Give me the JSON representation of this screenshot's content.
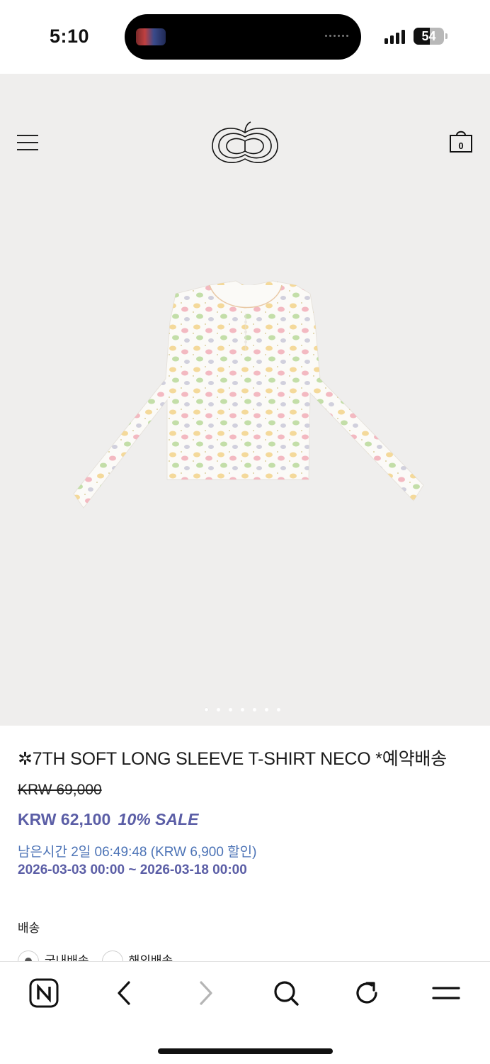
{
  "status_bar": {
    "time": "5:10",
    "battery": "54",
    "battery_level": 0.54,
    "signal_bars": 4
  },
  "header": {
    "menu_icon": "hamburger-menu-icon",
    "logo_icon": "apple-logo-icon",
    "cart_icon": "shopping-bag-icon",
    "cart_count": "0"
  },
  "gallery": {
    "image_icon": "long-sleeve-shirt-product-image",
    "slide_count": 7,
    "active_slide": 1
  },
  "product": {
    "title": "✲7TH SOFT LONG SLEEVE T-SHIRT NECO *예약배송",
    "original_price": "KRW 69,000",
    "sale_price": "KRW 62,100",
    "sale_badge": "10% SALE",
    "remaining_time": "남은시간 2일 06:49:48 (KRW 6,900 할인)",
    "sale_period": "2026-03-03 00:00 ~ 2026-03-18 00:00",
    "shipping_label": "배송",
    "shipping_options": [
      {
        "label": "국내배송",
        "selected": true
      },
      {
        "label": "해외배송",
        "selected": false
      }
    ]
  },
  "colors": {
    "accent_purple": "#5b5ea6",
    "accent_blue": "#4c73b6",
    "hero_bg": "#efeeed"
  },
  "browser_toolbar": {
    "buttons": [
      "naver-n-icon",
      "back-arrow-icon",
      "forward-arrow-icon",
      "search-icon",
      "reload-icon",
      "menu-icon"
    ]
  }
}
